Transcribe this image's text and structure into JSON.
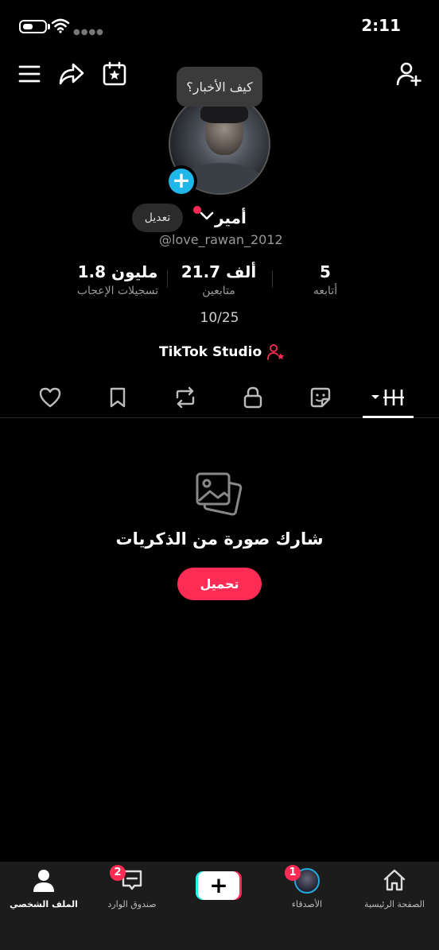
{
  "status_bar": {
    "time": "2:11"
  },
  "top_nav": {
    "icons": [
      "menu-icon",
      "share-icon",
      "calendar-star-icon",
      "add-user-icon"
    ]
  },
  "profile": {
    "bubble_text": "كيف الأخبار؟",
    "edit_label": "تعديل",
    "display_name": "أمير",
    "username": "@love_rawan_2012"
  },
  "stats": {
    "likes": {
      "value": "1.8 مليون",
      "label": "تسجيلات الإعجاب"
    },
    "followers": {
      "value": "21.7 ألف",
      "label": "متابعين"
    },
    "following": {
      "value": "5",
      "label": "أتابعه"
    }
  },
  "date_text": "10/25",
  "studio_label": "TikTok Studio",
  "tabs": [
    "liked-heart-icon",
    "favorites-bookmark-icon",
    "repost-icon",
    "private-lock-icon",
    "stickers-icon",
    "videos-grid-icon"
  ],
  "empty_state": {
    "title": "شارك صورة من الذكريات",
    "upload_label": "تحميل"
  },
  "bottom_nav": {
    "profile": "الملف الشخصي",
    "inbox": "صندوق الوارد",
    "inbox_badge": "2",
    "create": "+",
    "friends": "الأصدقاء",
    "friends_badge": "1",
    "home": "الصفحة الرئيسية"
  },
  "colors": {
    "accent": "#fe2c55",
    "add_avatar": "#21b6e8",
    "background": "#000000",
    "nav_bg": "#1c1c1c"
  }
}
